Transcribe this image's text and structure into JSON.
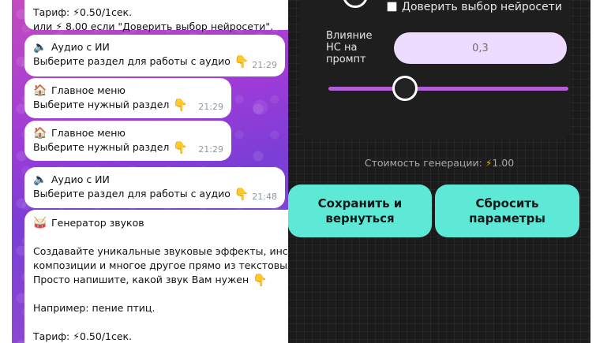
{
  "chat": {
    "messages": [
      {
        "line1": "Тариф: ⚡0.50/1сек.",
        "line2": "или ⚡ 8.00 если \"Доверить выбор нейросети\"."
      },
      {
        "title": "Аудио с ИИ",
        "icon": "speaker-icon",
        "text": "Выберите раздел для работы с аудио",
        "time": "21:29"
      },
      {
        "title": "Главное меню",
        "icon": "house-icon",
        "text": "Выберите нужный раздел",
        "time": "21:29"
      },
      {
        "title": "Главное меню",
        "icon": "house-icon",
        "text": "Выберите нужный раздел",
        "time": "21:29"
      },
      {
        "title": "Аудио с ИИ",
        "icon": "speaker-icon",
        "text": "Выберите раздел для работы с аудио",
        "time": "21:48"
      },
      {
        "title": "Генератор звуков",
        "icon": "drum-icon",
        "body1": "Создавайте уникальные звуковые эффекты, инстру",
        "body2": "композиции и многое другое прямо из текстовых о",
        "body3": "Просто напишите, какой звук Вам нужен",
        "example": "Например: пение птиц.",
        "tariff": "Тариф: ⚡0.50/1сек."
      }
    ]
  },
  "panel": {
    "trust_checkbox_label": "Доверить выбор нейросети",
    "trust_checked": false,
    "influence_label": "Влияние НС на промпт",
    "influence_value": "0,3",
    "cost_label": "Стоимость генерации:",
    "cost_value": "1.00",
    "save_button": "Сохранить и вернуться",
    "reset_button": "Сбросить параметры",
    "accent_color": "#5ee8d6",
    "slider_color": "#b35fd6"
  }
}
